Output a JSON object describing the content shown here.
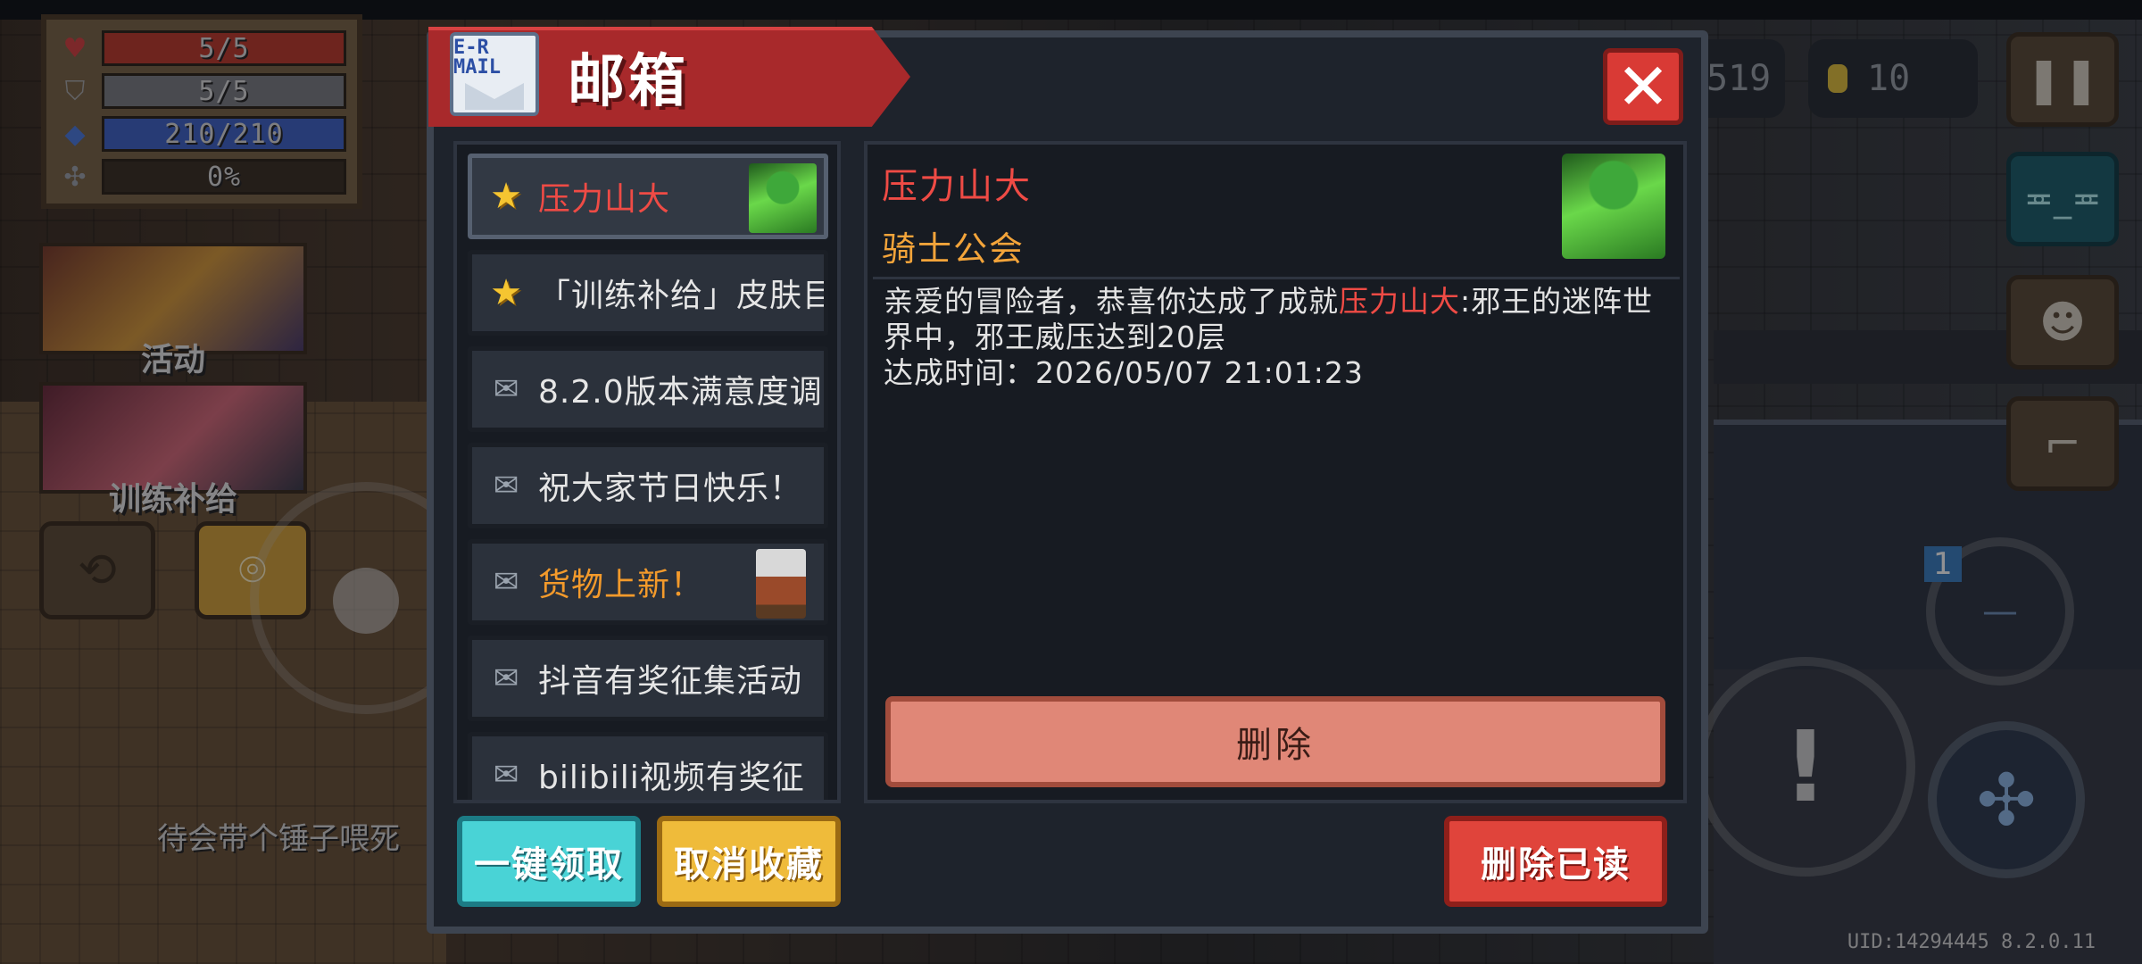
{
  "hud": {
    "health": "5/5",
    "armor": "5/5",
    "energy": "210/210",
    "skill": "0%",
    "health_fraction": 1.0,
    "armor_fraction": 1.0,
    "energy_fraction": 1.0,
    "skill_fraction": 0.0,
    "event_labels": [
      "活动",
      "训练补给"
    ],
    "npc_text": "待会带个锤子喂死",
    "gem_count": "519",
    "gold_count": "10",
    "badge": "1",
    "uid": "UID:14294445 8.2.0.11"
  },
  "dialog": {
    "title": "邮箱",
    "icon_text": "E-R MAIL",
    "close_label": "✕",
    "mails": [
      {
        "title": "压力山大",
        "icon": "star-icon",
        "style": "red",
        "selected": true,
        "thumb": "knight-guild-avatar"
      },
      {
        "title": "「训练补给」皮肤目",
        "icon": "star-icon",
        "style": "white"
      },
      {
        "title": "8.2.0版本满意度调",
        "icon": "envelope-icon",
        "style": "white"
      },
      {
        "title": "祝大家节日快乐！",
        "icon": "envelope-icon",
        "style": "white"
      },
      {
        "title": "货物上新！",
        "icon": "envelope-icon",
        "style": "orange",
        "thumb": "merchant-avatar"
      },
      {
        "title": "抖音有奖征集活动",
        "icon": "envelope-icon",
        "style": "white"
      },
      {
        "title": "bilibili视频有奖征",
        "icon": "envelope-icon",
        "style": "white"
      }
    ],
    "detail": {
      "title": "压力山大",
      "sender": "骑士公会",
      "body_prefix": "亲爱的冒险者，恭喜你达成了成就",
      "body_highlight": "压力山大",
      "body_suffix": ":邪王的迷阵世界中，邪王威压达到20层",
      "time_line": "达成时间：2026/05/07 21:01:23",
      "delete_label": "删除"
    },
    "buttons": {
      "claim_all": "一键领取",
      "unfavorite": "取消收藏",
      "delete_read": "删除已读"
    }
  },
  "colors": {
    "ribbon": "#a8292b",
    "highlight_red": "#ef4b45",
    "sender_orange": "#f3a43a",
    "claim_cyan": "#49d3d6",
    "unfav_yellow": "#efbb3a",
    "delete_read_red": "#e0443b"
  }
}
